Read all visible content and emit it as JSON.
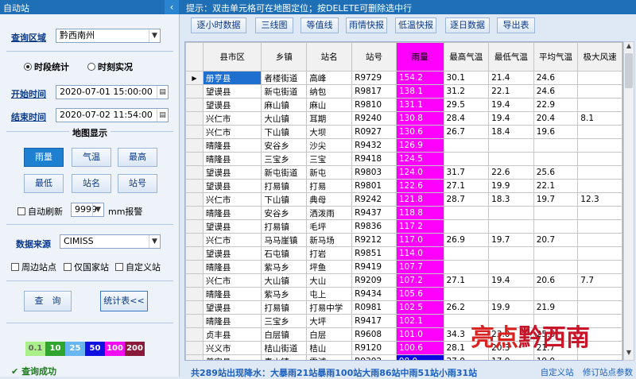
{
  "app_title": "自动站",
  "hint": "提示：双击单元格可在地图定位；按DELETE可删除选中行",
  "left": {
    "query_region_label": "查询区域",
    "query_region_value": "黔西南州",
    "radio_period": "时段统计",
    "radio_moment": "时刻实况",
    "start_label": "开始时间",
    "start_value": "2020-07-01 15:00:00",
    "end_label": "结束时间",
    "end_value": "2020-07-02 11:54:00",
    "map_section": "地图显示",
    "map_buttons": [
      "雨量",
      "气温",
      "最高",
      "最低",
      "站名",
      "站号"
    ],
    "auto_refresh": "自动刷新",
    "refresh_value": "9999",
    "mm_alarm": "mm报警",
    "data_source_label": "数据来源",
    "data_source_value": "CIMISS",
    "chk_nearby": "周边站点",
    "chk_national": "仅国家站",
    "chk_custom": "自定义站",
    "query_button": "查　询",
    "stats_button": "统计表<<",
    "legend": [
      {
        "label": "0.1",
        "color": "#a9f08a"
      },
      {
        "label": "10",
        "color": "#2fa52f"
      },
      {
        "label": "25",
        "color": "#67b6f2"
      },
      {
        "label": "50",
        "color": "#1010e0"
      },
      {
        "label": "100",
        "color": "#f20df2"
      },
      {
        "label": "200",
        "color": "#8a1a3a"
      }
    ],
    "status": "查询成功"
  },
  "toolbar": [
    "逐小时数据",
    "三线图",
    "等值线",
    "雨情快报",
    "低温快报",
    "逐日数据",
    "导出表"
  ],
  "table": {
    "headers": [
      "县市区",
      "乡镇",
      "站名",
      "站号",
      "雨量",
      "最高气温",
      "最低气温",
      "平均气温",
      "极大风速"
    ],
    "rows": [
      [
        "册亨县",
        "者楼街道",
        "高峰",
        "R9729",
        "154.2",
        "30.1",
        "21.4",
        "24.6",
        ""
      ],
      [
        "望谟县",
        "新屯街道",
        "纳包",
        "R9817",
        "138.1",
        "31.2",
        "22.1",
        "24.6",
        ""
      ],
      [
        "望谟县",
        "麻山镇",
        "麻山",
        "R9810",
        "131.1",
        "29.5",
        "19.4",
        "22.9",
        ""
      ],
      [
        "兴仁市",
        "大山镇",
        "耳期",
        "R9240",
        "130.8",
        "28.4",
        "19.4",
        "20.4",
        "8.1"
      ],
      [
        "兴仁市",
        "下山镇",
        "大坝",
        "R0927",
        "130.6",
        "26.7",
        "18.4",
        "19.6",
        ""
      ],
      [
        "晴隆县",
        "安谷乡",
        "沙尖",
        "R9432",
        "126.9",
        "",
        "",
        "",
        ""
      ],
      [
        "晴隆县",
        "三宝乡",
        "三宝",
        "R9418",
        "124.5",
        "",
        "",
        "",
        ""
      ],
      [
        "望谟县",
        "新屯街道",
        "新屯",
        "R9803",
        "124.0",
        "31.7",
        "22.6",
        "25.6",
        ""
      ],
      [
        "望谟县",
        "打易镇",
        "打易",
        "R9801",
        "122.6",
        "27.1",
        "19.9",
        "22.1",
        ""
      ],
      [
        "兴仁市",
        "下山镇",
        "典母",
        "R9242",
        "121.8",
        "28.7",
        "18.3",
        "19.7",
        "12.3"
      ],
      [
        "晴隆县",
        "安谷乡",
        "洒泼雨",
        "R9437",
        "118.8",
        "",
        "",
        "",
        ""
      ],
      [
        "望谟县",
        "打易镇",
        "毛坪",
        "R9836",
        "117.2",
        "",
        "",
        "",
        ""
      ],
      [
        "兴仁市",
        "马马崖镇",
        "新马场",
        "R9212",
        "117.0",
        "26.9",
        "19.7",
        "20.7",
        ""
      ],
      [
        "望谟县",
        "石屯镇",
        "打岩",
        "R9851",
        "114.0",
        "",
        "",
        "",
        ""
      ],
      [
        "晴隆县",
        "紫马乡",
        "坪鱼",
        "R9419",
        "107.7",
        "",
        "",
        "",
        ""
      ],
      [
        "兴仁市",
        "大山镇",
        "大山",
        "R9209",
        "107.2",
        "27.1",
        "19.4",
        "20.6",
        "7.7"
      ],
      [
        "晴隆县",
        "紫马乡",
        "屯上",
        "R9434",
        "105.6",
        "",
        "",
        "",
        ""
      ],
      [
        "望谟县",
        "打易镇",
        "打易中学",
        "R0981",
        "102.5",
        "26.2",
        "19.9",
        "21.9",
        ""
      ],
      [
        "晴隆县",
        "三宝乡",
        "大坪",
        "R9417",
        "102.1",
        "",
        "",
        "",
        ""
      ],
      [
        "贞丰县",
        "白层镇",
        "白层",
        "R9608",
        "101.0",
        "34.3",
        "23.0",
        "25.6",
        ""
      ],
      [
        "兴义市",
        "桔山街道",
        "桔山",
        "R9120",
        "100.6",
        "28.1",
        "20.3",
        "21.7",
        ""
      ],
      [
        "普安县",
        "青山镇",
        "雪浦",
        "R9302",
        "98.0",
        "27.0",
        "17.0",
        "19.0",
        ""
      ]
    ]
  },
  "summary": "共289站出现降水：大暴雨21站暴雨100站大雨86站中雨51站小雨31站",
  "links": [
    "自定义站",
    "修订站点参数"
  ],
  "watermark": {
    "a": "亮点",
    "b": "黔西南"
  }
}
